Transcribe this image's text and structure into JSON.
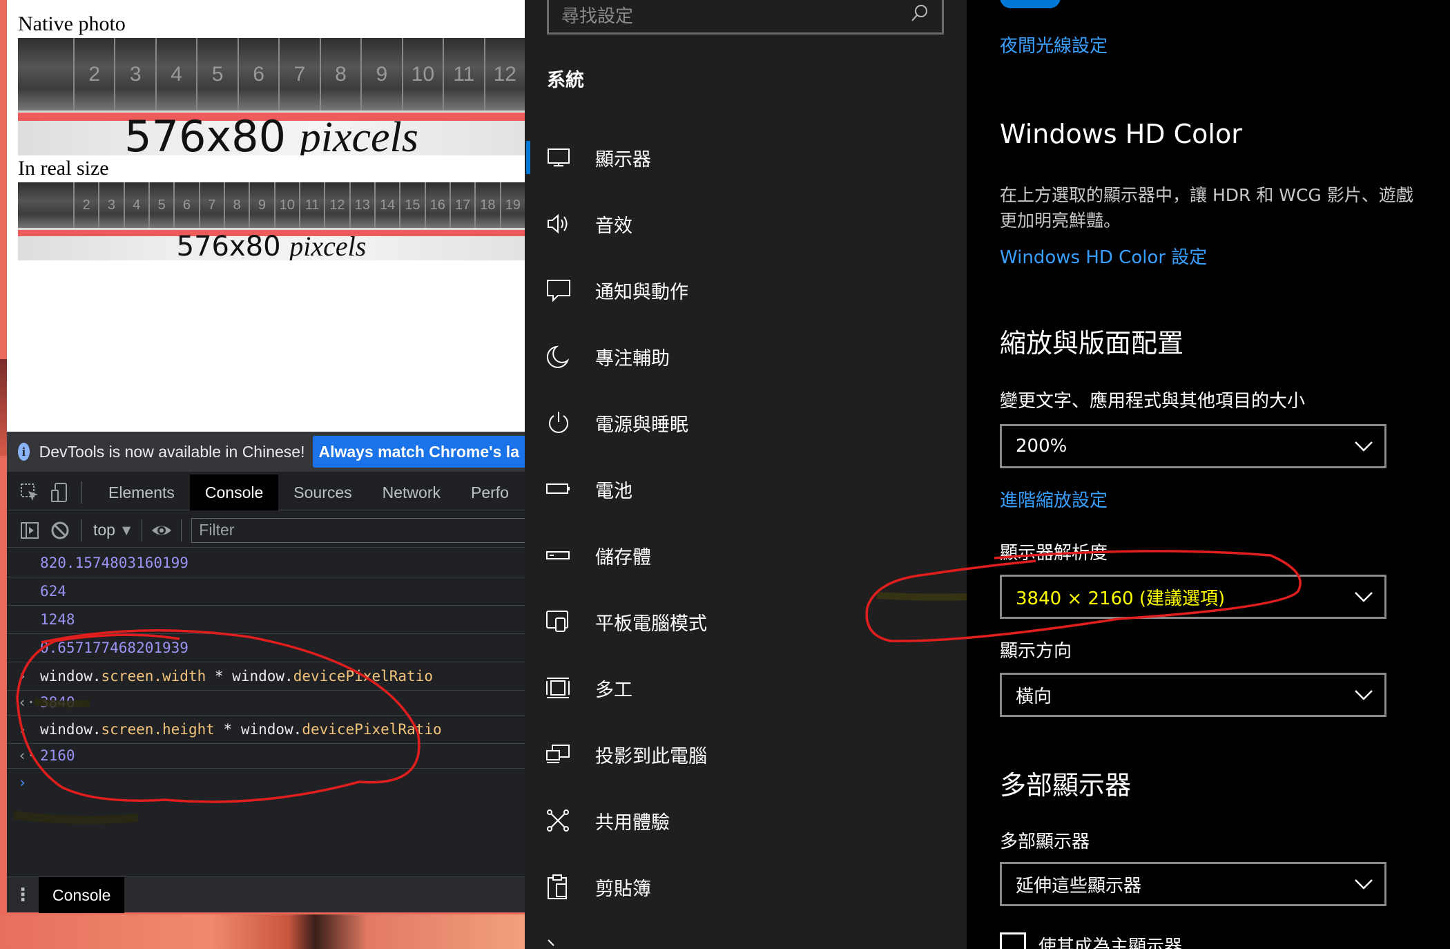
{
  "browser_page": {
    "native_caption": "Native photo",
    "real_caption": "In real size",
    "ruler_native": {
      "num": "576x80 ",
      "unit": "pixcels",
      "ticks": [
        "2",
        "3",
        "4",
        "5",
        "6",
        "7",
        "8",
        "9",
        "10",
        "11",
        "12"
      ]
    },
    "ruler_real": {
      "num": "576x80 ",
      "unit": "pixcels",
      "ticks": [
        "2",
        "3",
        "4",
        "5",
        "6",
        "7",
        "8",
        "9",
        "10",
        "11",
        "12",
        "13",
        "14",
        "15",
        "16",
        "17",
        "18",
        "19"
      ]
    }
  },
  "devtools": {
    "info_text": "DevTools is now available in Chinese!",
    "info_button": "Always match Chrome's la",
    "tabs": [
      "Elements",
      "Console",
      "Sources",
      "Network",
      "Perfo"
    ],
    "active_tab": "Console",
    "context": "top",
    "filter_placeholder": "Filter",
    "output_numbers": [
      "820.1574803160199",
      "624",
      "1248",
      "0.657177468201939"
    ],
    "cmd1": {
      "obj1": "window.",
      "prop1": "screen.width",
      "op": " * ",
      "obj2": "window.",
      "prop2": "devicePixelRatio"
    },
    "res1": "3840",
    "cmd2": {
      "obj1": "window.",
      "prop1": "screen.height",
      "op": " * ",
      "obj2": "window.",
      "prop2": "devicePixelRatio"
    },
    "res2": "2160",
    "drawer_tab": "Console"
  },
  "settings_nav": {
    "search_placeholder": "尋找設定",
    "header": "系統",
    "items": [
      {
        "label": "顯示器",
        "icon": "monitor-icon"
      },
      {
        "label": "音效",
        "icon": "speaker-icon"
      },
      {
        "label": "通知與動作",
        "icon": "notification-icon"
      },
      {
        "label": "專注輔助",
        "icon": "moon-icon"
      },
      {
        "label": "電源與睡眠",
        "icon": "power-icon"
      },
      {
        "label": "電池",
        "icon": "battery-icon"
      },
      {
        "label": "儲存體",
        "icon": "storage-icon"
      },
      {
        "label": "平板電腦模式",
        "icon": "tablet-mode-icon"
      },
      {
        "label": "多工",
        "icon": "multitasking-icon"
      },
      {
        "label": "投影到此電腦",
        "icon": "project-icon"
      },
      {
        "label": "共用體驗",
        "icon": "shared-experience-icon"
      },
      {
        "label": "剪貼簿",
        "icon": "clipboard-icon"
      }
    ]
  },
  "settings_content": {
    "night_light_link": "夜間光線設定",
    "hd_color_title": "Windows HD Color",
    "hd_color_desc_line1": "在上方選取的顯示器中，讓 HDR 和 WCG 影片、遊戲",
    "hd_color_desc_line2": "更加明亮鮮豔。",
    "hd_color_link": "Windows HD Color 設定",
    "scale_title": "縮放與版面配置",
    "scale_label": "變更文字、應用程式與其他項目的大小",
    "scale_value": "200%",
    "advanced_scaling_link": "進階縮放設定",
    "resolution_label": "顯示器解析度",
    "resolution_value": "3840 × 2160 (建議選項)",
    "orientation_label": "顯示方向",
    "orientation_value": "橫向",
    "multi_title": "多部顯示器",
    "multi_label": "多部顯示器",
    "multi_value": "延伸這些顯示器",
    "main_display_checkbox": "使其成為主顯示器"
  },
  "colors": {
    "accent": "#0078d7",
    "link": "#3aa0ff",
    "highlight_text": "#ffff00",
    "annotation": "#e01e1e"
  }
}
